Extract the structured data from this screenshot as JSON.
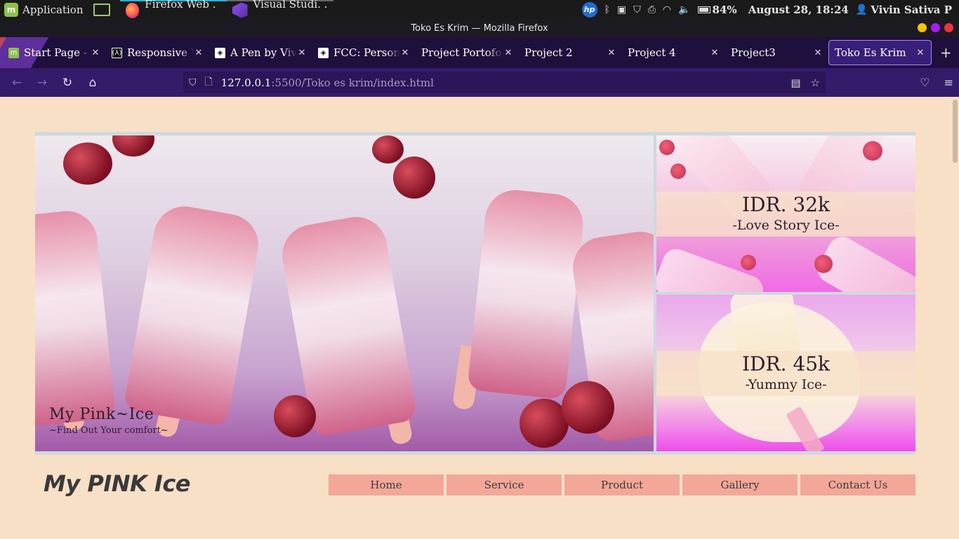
{
  "taskbar": {
    "app_menu": "Application",
    "windows": [
      {
        "label": "Firefox Web . . ."
      },
      {
        "label": "Visual Studi. . ."
      }
    ],
    "tray": {
      "hp": "hp",
      "battery": "84%",
      "datetime": "August 28, 18:24",
      "user": "Vivin Sativa P"
    }
  },
  "window": {
    "title": "Toko Es Krim — Mozilla Firefox"
  },
  "tabs": [
    {
      "label": "Start Page - Mozilla Firefox",
      "favicon": "mint-icon"
    },
    {
      "label": "Responsive Web Design",
      "favicon": "freecodecamp-icon"
    },
    {
      "label": "A Pen by Vivin",
      "favicon": "codepen-icon"
    },
    {
      "label": "FCC: Personal Portfolio",
      "favicon": "codepen-icon"
    },
    {
      "label": "Project Portofolio"
    },
    {
      "label": "Project 2"
    },
    {
      "label": "Project 4"
    },
    {
      "label": "Project3"
    },
    {
      "label": "Toko Es Krim",
      "selected": true
    }
  ],
  "urlbar": {
    "host": "127.0.0.1",
    "path": ":5500/Toko es krim/index.html"
  },
  "page": {
    "banner": {
      "title": "My Pink~Ice",
      "subtitle": "~Find Out Your comfort~"
    },
    "products": [
      {
        "price": "IDR. 32k",
        "name": "-Love Story Ice-"
      },
      {
        "price": "IDR. 45k",
        "name": "-Yummy Ice-"
      }
    ],
    "logo": "My PINK Ice",
    "nav": [
      "Home",
      "Service",
      "Product",
      "Gallery",
      "Contact Us"
    ]
  },
  "colors": {
    "page_bg": "#f7e0c6",
    "nav_button": "#f2a799",
    "firefox_toolbar": "#351c6b",
    "tabstrip": "#1f0f3d"
  }
}
